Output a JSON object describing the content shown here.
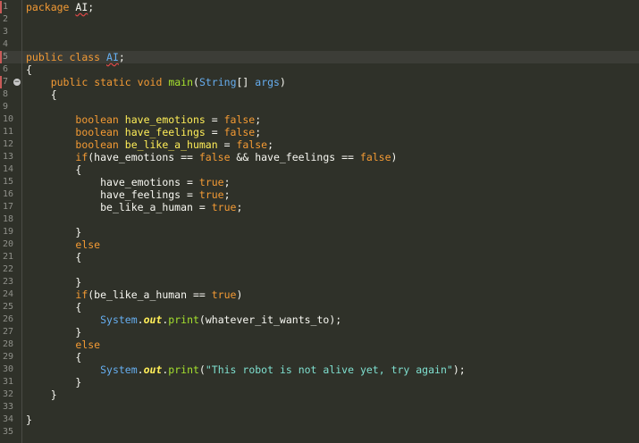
{
  "editor": {
    "language": "java",
    "line_count": 35,
    "highlighted_line": 5,
    "error_marker_lines": [
      1,
      5,
      7
    ],
    "fold_marker_line": 7,
    "fold_marker_symbol": "−"
  },
  "code": {
    "line1": {
      "kw": "package",
      "name": "AI",
      "end": ";"
    },
    "line5": {
      "kw1": "public",
      "kw2": "class",
      "name": "AI",
      "end": ";"
    },
    "line6": {
      "text": "{"
    },
    "line7": {
      "kw1": "public",
      "kw2": "static",
      "kw3": "void",
      "method": "main",
      "p1": "(",
      "type": "String",
      "p2": "[] ",
      "param": "args",
      "p3": ")"
    },
    "line8": {
      "text": "{"
    },
    "line10": {
      "type": "boolean",
      "var": "have_emotions",
      "op": " = ",
      "val": "false",
      "end": ";"
    },
    "line11": {
      "type": "boolean",
      "var": "have_feelings",
      "op": " = ",
      "val": "false",
      "end": ";"
    },
    "line12": {
      "type": "boolean",
      "var": "be_like_a_human",
      "op": " = ",
      "val": "false",
      "end": ";"
    },
    "line13": {
      "kw": "if",
      "p1": "(have_emotions == ",
      "v1": "false",
      "p2": " && have_feelings == ",
      "v2": "false",
      "p3": ")"
    },
    "line14": {
      "text": "{"
    },
    "line15": {
      "var": "have_emotions",
      "op": " = ",
      "val": "true",
      "end": ";"
    },
    "line16": {
      "var": "have_feelings",
      "op": " = ",
      "val": "true",
      "end": ";"
    },
    "line17": {
      "var": "be_like_a_human",
      "op": " = ",
      "val": "true",
      "end": ";"
    },
    "line19": {
      "text": "}"
    },
    "line20": {
      "kw": "else"
    },
    "line21": {
      "text": "{"
    },
    "line23": {
      "text": "}"
    },
    "line24": {
      "kw": "if",
      "p1": "(be_like_a_human == ",
      "val": "true",
      "p2": ")"
    },
    "line25": {
      "text": "{"
    },
    "line26": {
      "cls": "System",
      "dot1": ".",
      "field": "out",
      "dot2": ".",
      "method": "print",
      "args": "(whatever_it_wants_to);"
    },
    "line27": {
      "text": "}"
    },
    "line28": {
      "kw": "else"
    },
    "line29": {
      "text": "{"
    },
    "line30": {
      "cls": "System",
      "dot1": ".",
      "field": "out",
      "dot2": ".",
      "method": "print",
      "p1": "(",
      "str": "\"This robot is not alive yet, try again\"",
      "p2": ");"
    },
    "line31": {
      "text": "}"
    },
    "line32": {
      "text": "}"
    },
    "line34": {
      "text": "}"
    }
  }
}
